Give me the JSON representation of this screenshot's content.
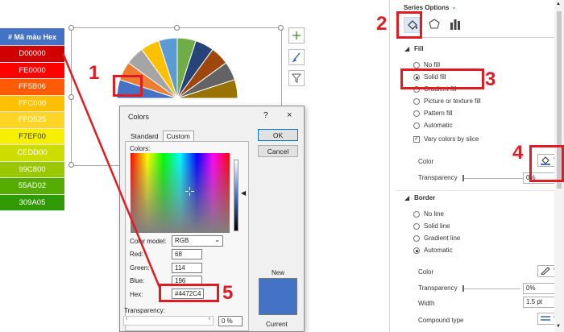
{
  "hex_list": {
    "header": "# Mã màu Hex",
    "rows": [
      {
        "label": "D00000",
        "color": "#d00000"
      },
      {
        "label": "FE0000",
        "color": "#fe0000"
      },
      {
        "label": "FF5B06",
        "color": "#ff5b06"
      },
      {
        "label": "FFC000",
        "color": "#ffc000"
      },
      {
        "label": "FFD525",
        "color": "#ffd525"
      },
      {
        "label": "F7EF00",
        "color": "#f7ef00"
      },
      {
        "label": "CEDD00",
        "color": "#cedd00"
      },
      {
        "label": "99C800",
        "color": "#99c800"
      },
      {
        "label": "55AD02",
        "color": "#55ad02"
      },
      {
        "label": "309A05",
        "color": "#309a05"
      }
    ]
  },
  "pie_slice_colors": [
    "#4472c4",
    "#ed7d31",
    "#a5a5a5",
    "#ffc000",
    "#5b9bd5",
    "#70ad47",
    "#264478",
    "#9e480e",
    "#636363",
    "#997300"
  ],
  "colors_dialog": {
    "title": "Colors",
    "help": "?",
    "close": "×",
    "tab_standard": "Standard",
    "tab_custom": "Custom",
    "colors_label": "Colors:",
    "color_model_label": "Color model:",
    "color_model_value": "RGB",
    "red_label": "Red:",
    "red_value": "68",
    "green_label": "Green:",
    "green_value": "114",
    "blue_label": "Blue:",
    "blue_value": "196",
    "hex_label": "Hex:",
    "hex_value": "#4472C4",
    "transparency_label": "Transparency:",
    "transparency_value": "0 %",
    "ok": "OK",
    "cancel": "Cancel",
    "new_label": "New",
    "current_label": "Current",
    "new_color": "#4472c4"
  },
  "format_pane": {
    "header": "Series Options",
    "fill_section": "Fill",
    "fill_options": [
      "No fill",
      "Solid fill",
      "Gradient fill",
      "Picture or texture fill",
      "Pattern fill",
      "Automatic"
    ],
    "fill_selected": "Solid fill",
    "vary_colors": "Vary colors by slice",
    "vary_colors_checked": true,
    "color_label": "Color",
    "transparency_label": "Transparency",
    "transparency_value": "0%",
    "border_section": "Border",
    "border_options": [
      "No line",
      "Solid line",
      "Gradient line",
      "Automatic"
    ],
    "border_selected": "Automatic",
    "border_color_label": "Color",
    "border_transparency_label": "Transparency",
    "border_transparency_value": "0%",
    "width_label": "Width",
    "width_value": "1.5 pt",
    "compound_label": "Compound type"
  },
  "annotations": [
    "1",
    "2",
    "3",
    "4",
    "5"
  ],
  "annotation_color": "#e01b22"
}
